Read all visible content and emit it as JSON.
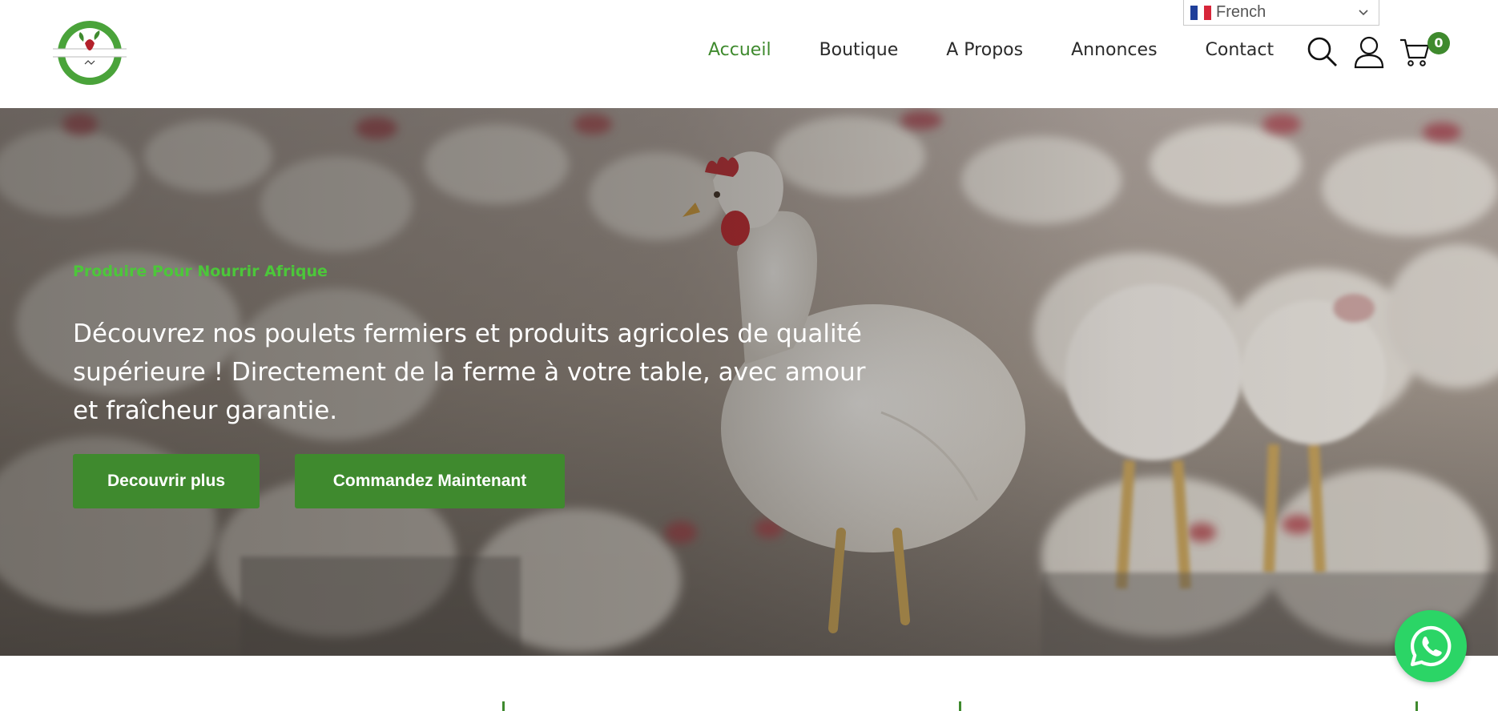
{
  "header": {
    "logo_alt": "Logo",
    "language": {
      "selected": "French"
    },
    "nav": [
      {
        "label": "Accueil",
        "active": true
      },
      {
        "label": "Boutique",
        "active": false
      },
      {
        "label": "A Propos",
        "active": false
      },
      {
        "label": "Annonces",
        "active": false
      },
      {
        "label": "Contact",
        "active": false
      }
    ],
    "icons": [
      "search-icon",
      "user-icon",
      "cart-icon"
    ],
    "cart_count": "0"
  },
  "hero": {
    "tagline": "Produire Pour Nourrir Afrique",
    "text": "Découvrez nos poulets fermiers et produits agricoles de qualité supérieure ! Directement de la ferme à votre table, avec amour et fraîcheur garantie.",
    "buttons": {
      "discover": "Decouvrir plus",
      "order": "Commandez Maintenant"
    }
  },
  "colors": {
    "brand_green": "#3f8a2e",
    "tagline_green": "#4cc73a",
    "whatsapp_green": "#2bd566"
  }
}
